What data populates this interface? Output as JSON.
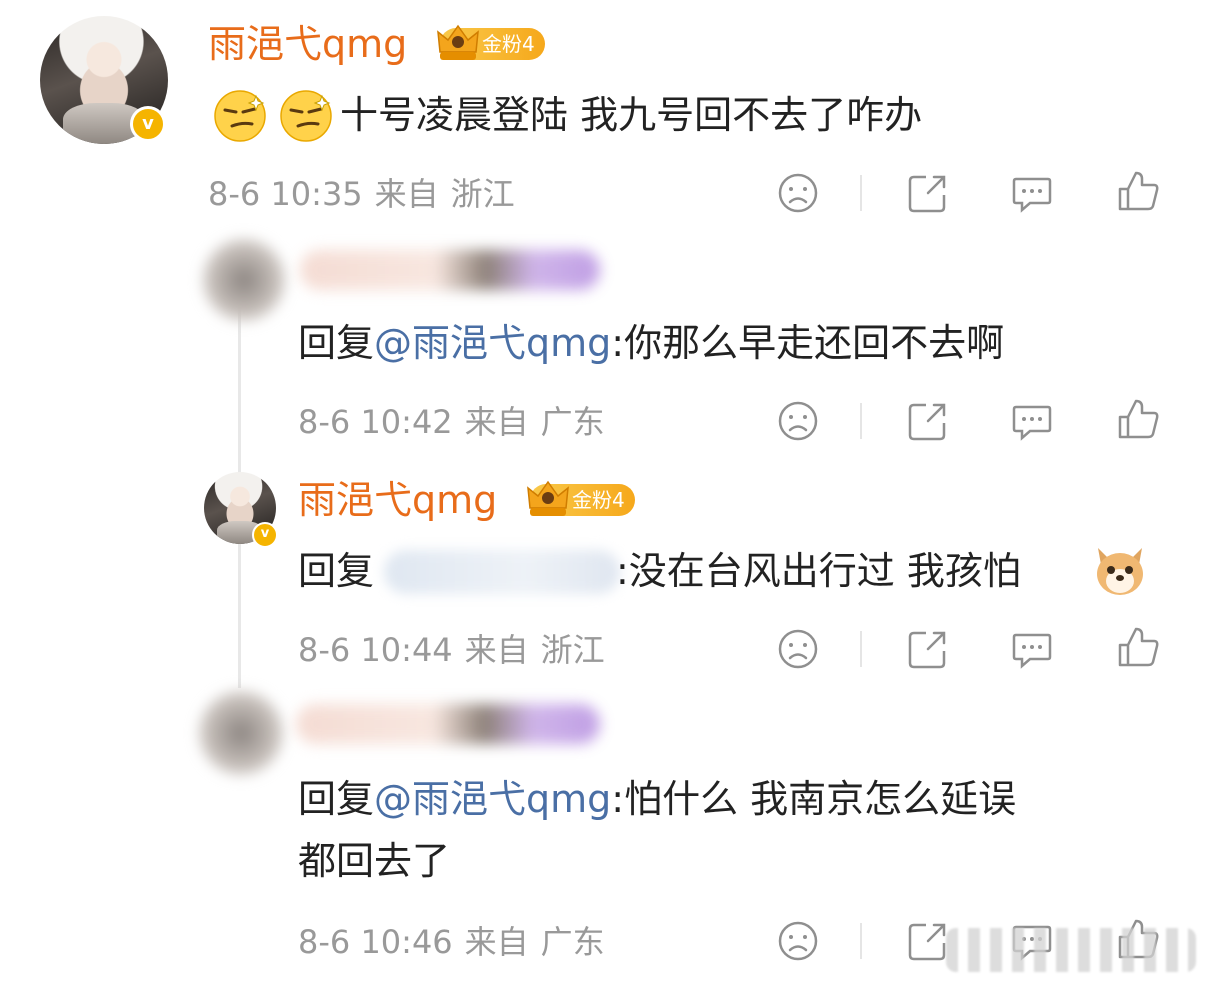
{
  "comments": [
    {
      "user": "雨浥弋qmg",
      "badge": "金粉4",
      "text": "十号凌晨登陆 我九号回不去了咋办",
      "date": "8-6 10:35",
      "from": "来自",
      "location": "浙江"
    },
    {
      "prefix": "回复",
      "mention": "@雨浥弋qmg",
      "text": ":你那么早走还回不去啊",
      "date": "8-6 10:42",
      "from": "来自",
      "location": "广东"
    },
    {
      "user": "雨浥弋qmg",
      "badge": "金粉4",
      "prefix": "回复",
      "text": ":没在台风出行过 我孩怕",
      "date": "8-6 10:44",
      "from": "来自",
      "location": "浙江"
    },
    {
      "prefix": "回复",
      "mention": "@雨浥弋qmg",
      "text": ":怕什么 我南京怎么延误",
      "text_line2": "都回去了",
      "date": "8-6 10:46",
      "from": "来自",
      "location": "广东"
    }
  ],
  "icons": [
    "dislike-icon",
    "share-icon",
    "comment-icon",
    "like-icon",
    "verified-icon",
    "crown-icon",
    "smirk-emoji",
    "dog-emoji"
  ],
  "colors": {
    "username": "#e86c1a",
    "mention": "#4a6fa5",
    "meta": "#999999",
    "badge": "#f6a81b",
    "verified": "#f5b400"
  }
}
